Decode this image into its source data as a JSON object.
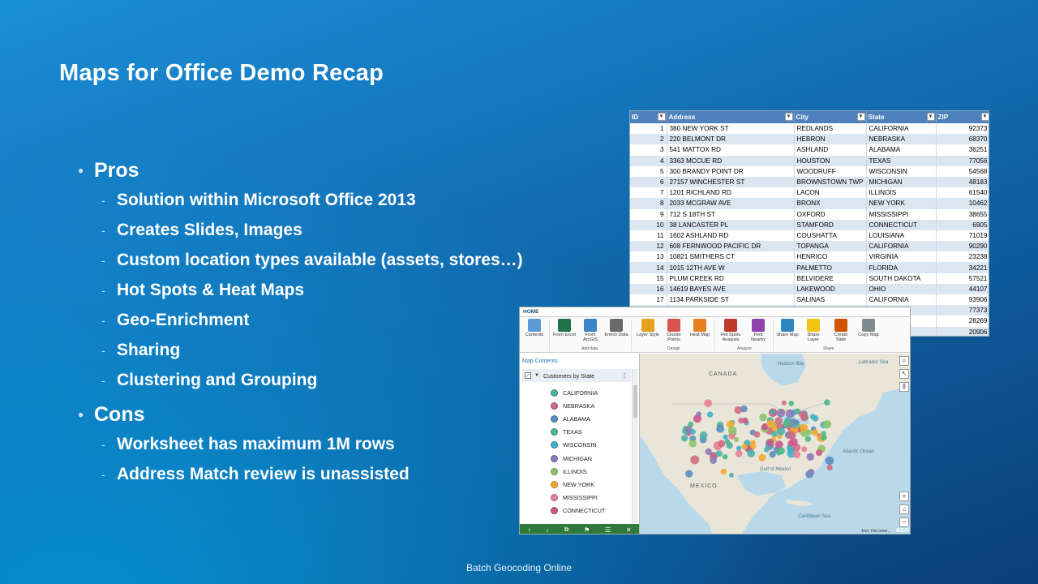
{
  "slide": {
    "title": "Maps for Office Demo Recap",
    "footer": "Batch Geocoding Online"
  },
  "pros": {
    "heading": "Pros",
    "items": [
      "Solution within Microsoft Office 2013",
      "Creates Slides, Images",
      "Custom location types available (assets, stores…)",
      "Hot Spots & Heat Maps",
      "Geo-Enrichment",
      "Sharing",
      "Clustering and Grouping"
    ]
  },
  "cons": {
    "heading": "Cons",
    "items": [
      "Worksheet has maximum 1M rows",
      "Address Match review is unassisted"
    ]
  },
  "sheet": {
    "headers": [
      "ID",
      "Address",
      "City",
      "State",
      "ZIP"
    ],
    "rows": [
      [
        "1",
        "380 NEW YORK ST",
        "REDLANDS",
        "CALIFORNIA",
        "92373"
      ],
      [
        "2",
        "220 BELMONT DR",
        "HEBRON",
        "NEBRASKA",
        "68370"
      ],
      [
        "3",
        "541 MATTOX RD",
        "ASHLAND",
        "ALABAMA",
        "36251"
      ],
      [
        "4",
        "3363 MCCUE RD",
        "HOUSTON",
        "TEXAS",
        "77056"
      ],
      [
        "5",
        "300 BRANDY POINT DR",
        "WOODRUFF",
        "WISCONSIN",
        "54568"
      ],
      [
        "6",
        "27157 WINCHESTER ST",
        "BROWNSTOWN TWP",
        "MICHIGAN",
        "48183"
      ],
      [
        "7",
        "1201 RICHLAND RD",
        "LACON",
        "ILLINOIS",
        "61540"
      ],
      [
        "8",
        "2033 MCGRAW AVE",
        "BRONX",
        "NEW YORK",
        "10462"
      ],
      [
        "9",
        "712 S 18TH ST",
        "OXFORD",
        "MISSISSIPPI",
        "38655"
      ],
      [
        "10",
        "38 LANCASTER PL",
        "STAMFORD",
        "CONNECTICUT",
        "6905"
      ],
      [
        "11",
        "1602 ASHLAND RD",
        "COUSHATTA",
        "LOUISIANA",
        "71019"
      ],
      [
        "12",
        "608 FERNWOOD PACIFIC DR",
        "TOPANGA",
        "CALIFORNIA",
        "90290"
      ],
      [
        "13",
        "10821 SMITHERS CT",
        "HENRICO",
        "VIRGINIA",
        "23238"
      ],
      [
        "14",
        "1015 12TH AVE W",
        "PALMETTO",
        "FLORIDA",
        "34221"
      ],
      [
        "15",
        "PLUM CREEK RD",
        "BELVIDERE",
        "SOUTH DAKOTA",
        "57521"
      ],
      [
        "16",
        "14619 BAYES AVE",
        "LAKEWOOD",
        "OHIO",
        "44107"
      ],
      [
        "17",
        "1134 PARKSIDE ST",
        "SALINAS",
        "CALIFORNIA",
        "93906"
      ],
      [
        "",
        "",
        "",
        "",
        "77373"
      ],
      [
        "",
        "",
        "",
        "OLINA",
        "28269"
      ],
      [
        "",
        "",
        "",
        "",
        "20906"
      ]
    ]
  },
  "mapapp": {
    "tab": "HOME",
    "buttons": [
      {
        "label": "Contents",
        "icon": "contents-icon",
        "color": "#5b9bd5"
      },
      {
        "label": "From Excel",
        "icon": "excel-icon",
        "color": "#217346"
      },
      {
        "label": "From ArcGIS",
        "icon": "arcgis-icon",
        "color": "#3a87c8"
      },
      {
        "label": "Enrich Data",
        "icon": "enrich-icon",
        "color": "#6a6a6a"
      },
      {
        "label": "Layer Style",
        "icon": "layer-style-icon",
        "color": "#e3a21a"
      },
      {
        "label": "Cluster Points",
        "icon": "cluster-icon",
        "color": "#d9534f"
      },
      {
        "label": "Heat Map",
        "icon": "heatmap-icon",
        "color": "#e67e22"
      },
      {
        "label": "Hot Spots Analysis",
        "icon": "hotspots-icon",
        "color": "#c0392b"
      },
      {
        "label": "Find Nearby",
        "icon": "find-nearby-icon",
        "color": "#8e44ad"
      },
      {
        "label": "Share Map",
        "icon": "share-map-icon",
        "color": "#2e86c1"
      },
      {
        "label": "Share Layer",
        "icon": "share-layer-icon",
        "color": "#f1c40f"
      },
      {
        "label": "Create Slide",
        "icon": "slide-icon",
        "color": "#d35400"
      },
      {
        "label": "Copy Map",
        "icon": "copy-map-icon",
        "color": "#7f8c8d"
      }
    ],
    "groups": [
      "Add data",
      "Design",
      "Analyze",
      "Share"
    ],
    "map_contents_title": "Map Contents",
    "layer_name": "Customers by State",
    "legend": [
      {
        "label": "CALIFORNIA",
        "color": "#4fb0a8"
      },
      {
        "label": "NEBRASKA",
        "color": "#d06b82"
      },
      {
        "label": "ALABAMA",
        "color": "#5a8fbf"
      },
      {
        "label": "TEXAS",
        "color": "#4fb58a"
      },
      {
        "label": "WISCONSIN",
        "color": "#3fb0c9"
      },
      {
        "label": "MICHIGAN",
        "color": "#8c7bb5"
      },
      {
        "label": "ILLINOIS",
        "color": "#8dc26b"
      },
      {
        "label": "NEW YORK",
        "color": "#f2a830"
      },
      {
        "label": "MISSISSIPPI",
        "color": "#e57f95"
      },
      {
        "label": "CONNECTICUT",
        "color": "#c9588a"
      }
    ],
    "map_labels": {
      "canada": "CANADA",
      "mexico": "MEXICO",
      "atlantic": "Atlantic Ocean",
      "hudson": "Hudson Bay",
      "labrador": "Labrador Sea",
      "caribbean": "Caribbean Sea",
      "gulf": "Gulf of Mexico",
      "attribution": "Esri, DeLorme,...",
      "esri": "esri"
    }
  }
}
